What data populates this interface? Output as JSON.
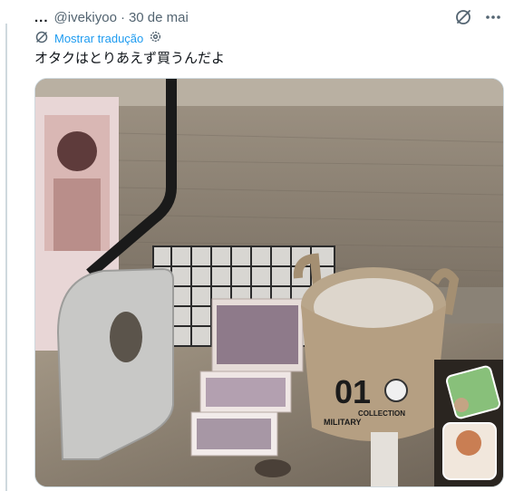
{
  "tweet": {
    "name_ellipsis": "...",
    "handle": "@ivekiyoo",
    "separator": "·",
    "date": "30 de mai",
    "translate_label": "Mostrar tradução",
    "text": "オタクはとりあえず買うんだよ"
  },
  "photo": {
    "box_number": "01",
    "box_caption_line1": "MILITARY",
    "box_caption_line2": "COLLECTION"
  },
  "colors": {
    "link": "#1d9bf0",
    "muted": "#536471",
    "text": "#0f1419",
    "border": "#cfd9de"
  },
  "icons": {
    "grok": "grok-icon",
    "more": "more-options-icon",
    "translate": "translate-icon",
    "settings": "settings-gear-icon"
  }
}
